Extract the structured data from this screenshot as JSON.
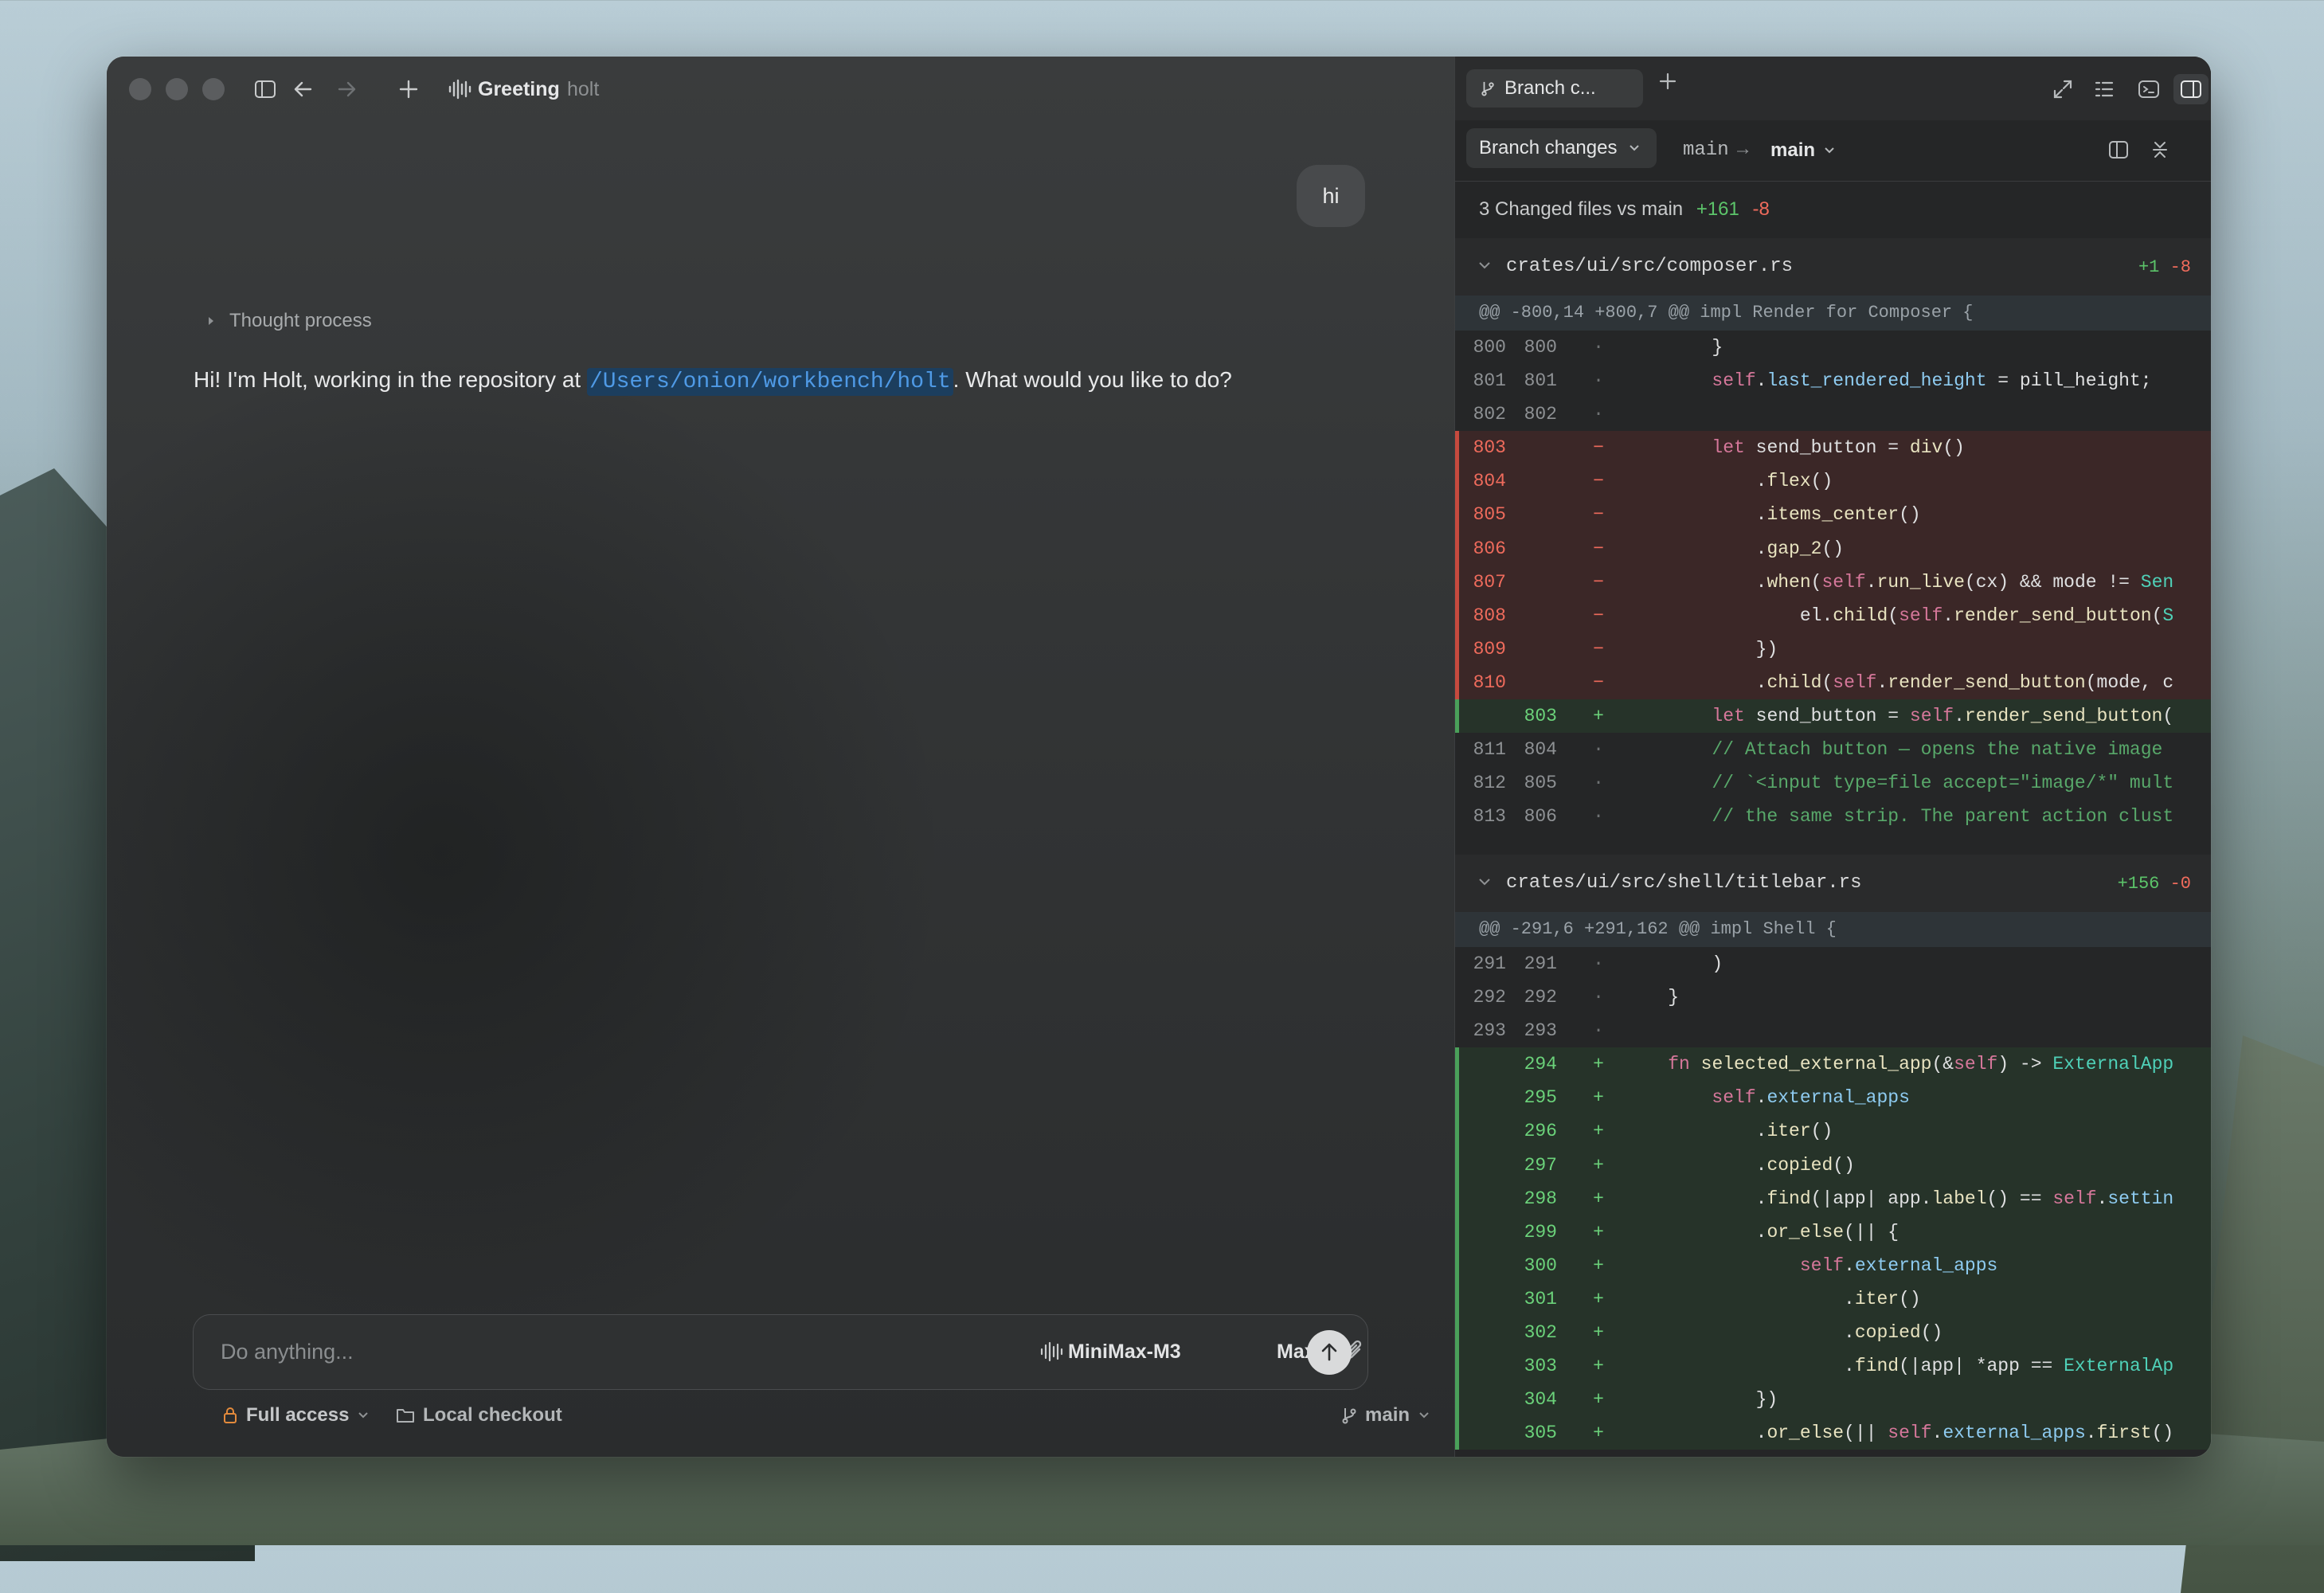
{
  "window": {
    "nav": {
      "title": "Greeting",
      "subtitle": "holt"
    }
  },
  "chat": {
    "user_message": "hi",
    "thought_label": "Thought process",
    "assistant_prefix": "Hi! I'm Holt, working in the repository at ",
    "assistant_path": "/Users/onion/workbench/holt",
    "assistant_suffix": ". What would you like to do?"
  },
  "composer": {
    "placeholder": "Do anything...",
    "model": "MiniMax-M3",
    "effort": "Max"
  },
  "bottom_bar": {
    "access": "Full access",
    "checkout": "Local checkout",
    "branch": "main"
  },
  "diff_panel": {
    "tab_label": "Branch c...",
    "view_label": "Branch changes",
    "base_ref": "main",
    "arrow": "→",
    "head_ref": "main",
    "summary_text": "3 Changed files vs main",
    "summary_add": "+161",
    "summary_del": "-8",
    "files": [
      {
        "name": "crates/ui/src/composer.rs",
        "add": "+1",
        "del": "-8",
        "hunk": "@@ -800,14 +800,7 @@ impl Render for Composer {",
        "lines": [
          {
            "t": "ctx",
            "a": "800",
            "b": "800",
            "code": "        }"
          },
          {
            "t": "ctx",
            "a": "801",
            "b": "801",
            "code": "        self.last_rendered_height = pill_height;"
          },
          {
            "t": "ctx",
            "a": "802",
            "b": "802",
            "code": ""
          },
          {
            "t": "del",
            "a": "803",
            "b": "",
            "code": "        let send_button = div()"
          },
          {
            "t": "del",
            "a": "804",
            "b": "",
            "code": "            .flex()"
          },
          {
            "t": "del",
            "a": "805",
            "b": "",
            "code": "            .items_center()"
          },
          {
            "t": "del",
            "a": "806",
            "b": "",
            "code": "            .gap_2()"
          },
          {
            "t": "del",
            "a": "807",
            "b": "",
            "code": "            .when(self.run_live(cx) && mode != Sen"
          },
          {
            "t": "del",
            "a": "808",
            "b": "",
            "code": "                el.child(self.render_send_button(S"
          },
          {
            "t": "del",
            "a": "809",
            "b": "",
            "code": "            })"
          },
          {
            "t": "del",
            "a": "810",
            "b": "",
            "code": "            .child(self.render_send_button(mode, c"
          },
          {
            "t": "add",
            "a": "",
            "b": "803",
            "code": "        let send_button = self.render_send_button("
          },
          {
            "t": "ctx",
            "a": "811",
            "b": "804",
            "code": "        // Attach button — opens the native image"
          },
          {
            "t": "ctx",
            "a": "812",
            "b": "805",
            "code": "        // `<input type=file accept=\"image/*\" mult"
          },
          {
            "t": "ctx",
            "a": "813",
            "b": "806",
            "code": "        // the same strip. The parent action clust"
          }
        ]
      },
      {
        "name": "crates/ui/src/shell/titlebar.rs",
        "add": "+156",
        "del": "-0",
        "hunk": "@@ -291,6 +291,162 @@ impl Shell {",
        "lines": [
          {
            "t": "ctx",
            "a": "291",
            "b": "291",
            "code": "        )"
          },
          {
            "t": "ctx",
            "a": "292",
            "b": "292",
            "code": "    }"
          },
          {
            "t": "ctx",
            "a": "293",
            "b": "293",
            "code": ""
          },
          {
            "t": "add",
            "a": "",
            "b": "294",
            "code": "    fn selected_external_app(&self) -> ExternalApp"
          },
          {
            "t": "add",
            "a": "",
            "b": "295",
            "code": "        self.external_apps"
          },
          {
            "t": "add",
            "a": "",
            "b": "296",
            "code": "            .iter()"
          },
          {
            "t": "add",
            "a": "",
            "b": "297",
            "code": "            .copied()"
          },
          {
            "t": "add",
            "a": "",
            "b": "298",
            "code": "            .find(|app| app.label() == self.settin"
          },
          {
            "t": "add",
            "a": "",
            "b": "299",
            "code": "            .or_else(|| {"
          },
          {
            "t": "add",
            "a": "",
            "b": "300",
            "code": "                self.external_apps"
          },
          {
            "t": "add",
            "a": "",
            "b": "301",
            "code": "                    .iter()"
          },
          {
            "t": "add",
            "a": "",
            "b": "302",
            "code": "                    .copied()"
          },
          {
            "t": "add",
            "a": "",
            "b": "303",
            "code": "                    .find(|app| *app == ExternalAp"
          },
          {
            "t": "add",
            "a": "",
            "b": "304",
            "code": "            })"
          },
          {
            "t": "add",
            "a": "",
            "b": "305",
            "code": "            .or_else(|| self.external_apps.first()"
          }
        ]
      }
    ]
  },
  "colors": {
    "add": "#5cc46a",
    "del": "#ef6b5c",
    "link": "#4f9ae6"
  }
}
